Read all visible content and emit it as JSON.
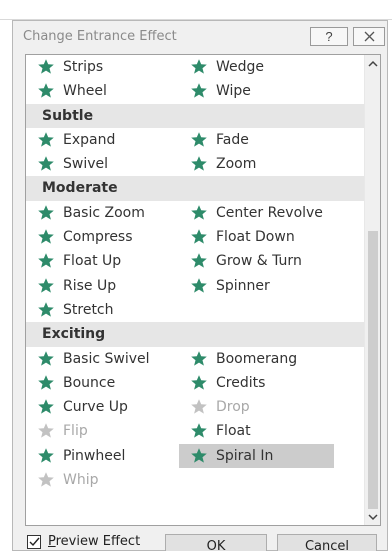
{
  "dialog": {
    "title": "Change Entrance Effect",
    "help_glyph": "?",
    "buttons": {
      "ok": "OK",
      "cancel": "Cancel"
    },
    "preview_effect": {
      "label": "Preview Effect",
      "checked": true
    }
  },
  "list": {
    "rows": [
      {
        "type": "items",
        "left": {
          "label": "Strips",
          "enabled": true
        },
        "right": {
          "label": "Wedge",
          "enabled": true
        }
      },
      {
        "type": "items",
        "left": {
          "label": "Wheel",
          "enabled": true
        },
        "right": {
          "label": "Wipe",
          "enabled": true
        }
      },
      {
        "type": "group",
        "label": "Subtle"
      },
      {
        "type": "items",
        "left": {
          "label": "Expand",
          "enabled": true
        },
        "right": {
          "label": "Fade",
          "enabled": true
        }
      },
      {
        "type": "items",
        "left": {
          "label": "Swivel",
          "enabled": true
        },
        "right": {
          "label": "Zoom",
          "enabled": true
        }
      },
      {
        "type": "group",
        "label": "Moderate"
      },
      {
        "type": "items",
        "left": {
          "label": "Basic Zoom",
          "enabled": true
        },
        "right": {
          "label": "Center Revolve",
          "enabled": true
        }
      },
      {
        "type": "items",
        "left": {
          "label": "Compress",
          "enabled": true
        },
        "right": {
          "label": "Float Down",
          "enabled": true
        }
      },
      {
        "type": "items",
        "left": {
          "label": "Float Up",
          "enabled": true
        },
        "right": {
          "label": "Grow & Turn",
          "enabled": true
        }
      },
      {
        "type": "items",
        "left": {
          "label": "Rise Up",
          "enabled": true
        },
        "right": {
          "label": "Spinner",
          "enabled": true
        }
      },
      {
        "type": "items",
        "left": {
          "label": "Stretch",
          "enabled": true
        }
      },
      {
        "type": "group",
        "label": "Exciting"
      },
      {
        "type": "items",
        "left": {
          "label": "Basic Swivel",
          "enabled": true
        },
        "right": {
          "label": "Boomerang",
          "enabled": true
        }
      },
      {
        "type": "items",
        "left": {
          "label": "Bounce",
          "enabled": true
        },
        "right": {
          "label": "Credits",
          "enabled": true
        }
      },
      {
        "type": "items",
        "left": {
          "label": "Curve Up",
          "enabled": true
        },
        "right": {
          "label": "Drop",
          "enabled": false
        }
      },
      {
        "type": "items",
        "left": {
          "label": "Flip",
          "enabled": false
        },
        "right": {
          "label": "Float",
          "enabled": true
        }
      },
      {
        "type": "items",
        "left": {
          "label": "Pinwheel",
          "enabled": true
        },
        "right": {
          "label": "Spiral In",
          "enabled": true,
          "selected": true
        }
      },
      {
        "type": "items",
        "left": {
          "label": "Whip",
          "enabled": false
        }
      }
    ]
  },
  "colors": {
    "star_enabled": "#2e8b6a",
    "star_disabled": "#c2c2c2",
    "selection": "#cccccc",
    "group_header_bg": "#e6e6e6"
  },
  "icons": {
    "effect": "star-icon",
    "help": "question-icon",
    "close": "close-icon",
    "scroll_up": "chevron-up-icon",
    "scroll_down": "chevron-down-icon",
    "checkbox": "check-icon"
  }
}
